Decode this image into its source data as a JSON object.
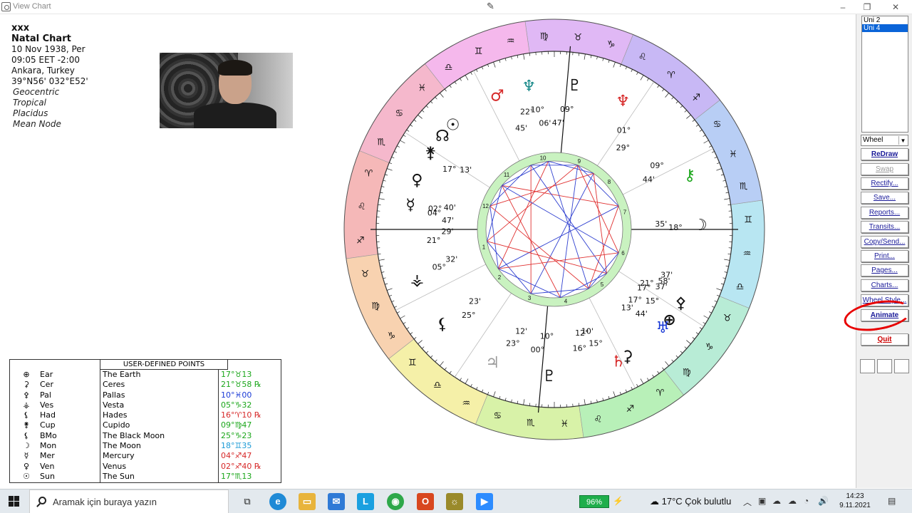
{
  "window": {
    "title": "View Chart"
  },
  "chart_info": {
    "name": "xxx",
    "type": "Natal Chart",
    "date": "10 Nov 1938, Per",
    "time": "09:05 EET -2:00",
    "place": "Ankara, Turkey",
    "coords": "39°N56' 032°E52'",
    "options": [
      "Geocentric",
      "Tropical",
      "Placidus",
      "Mean Node"
    ]
  },
  "udp": {
    "title": "USER-DEFINED POINTS",
    "rows": [
      {
        "glyph": "⊕",
        "abbr": "Ear",
        "name": "The Earth",
        "pos": "17°♉13",
        "color": "#1aa61a"
      },
      {
        "glyph": "⚳",
        "abbr": "Cer",
        "name": "Ceres",
        "pos": "21°♉58 ℞",
        "color": "#1aa61a"
      },
      {
        "glyph": "⚴",
        "abbr": "Pal",
        "name": "Pallas",
        "pos": "10°♓00",
        "color": "#1a3ad6"
      },
      {
        "glyph": "⚶",
        "abbr": "Ves",
        "name": "Vesta",
        "pos": "05°♑32",
        "color": "#1aa61a"
      },
      {
        "glyph": "⚸",
        "abbr": "Had",
        "name": "Hades",
        "pos": "16°♈10 ℞",
        "color": "#d62828"
      },
      {
        "glyph": "⚵",
        "abbr": "Cup",
        "name": "Cupido",
        "pos": "09°♍47",
        "color": "#1aa61a"
      },
      {
        "glyph": "⚸",
        "abbr": "BMo",
        "name": "The Black Moon",
        "pos": "25°♑23",
        "color": "#1aa61a"
      },
      {
        "glyph": "☽",
        "abbr": "Mon",
        "name": "The Moon",
        "pos": "18°♊35",
        "color": "#1a9ad6"
      },
      {
        "glyph": "☿",
        "abbr": "Mer",
        "name": "Mercury",
        "pos": "04°♐47",
        "color": "#d62828"
      },
      {
        "glyph": "♀",
        "abbr": "Ven",
        "name": "Venus",
        "pos": "02°♐40 ℞",
        "color": "#d62828"
      },
      {
        "glyph": "☉",
        "abbr": "Sun",
        "name": "The Sun",
        "pos": "17°♏13",
        "color": "#1aa61a"
      }
    ]
  },
  "side": {
    "universes": [
      "Uni 2",
      "Uni 4"
    ],
    "view_select": "Wheel",
    "buttons": [
      {
        "label": "ReDraw",
        "state": "bold"
      },
      {
        "label": "Swap",
        "state": "disabled"
      },
      {
        "label": "Rectify...",
        "state": ""
      },
      {
        "label": "Save...",
        "state": ""
      },
      {
        "label": "Reports...",
        "state": ""
      },
      {
        "label": "Transits...",
        "state": ""
      },
      {
        "label": "Copy/Send...",
        "state": ""
      },
      {
        "label": "Print...",
        "state": ""
      },
      {
        "label": "Pages...",
        "state": ""
      },
      {
        "label": "Charts...",
        "state": ""
      },
      {
        "label": "Wheel Style...",
        "state": ""
      },
      {
        "label": "Animate",
        "state": "bold"
      },
      {
        "label": "Quit",
        "state": "red"
      }
    ]
  },
  "wheel": {
    "sign_glyphs": [
      "♈",
      "♉",
      "♊",
      "♋",
      "♌",
      "♍",
      "♎",
      "♏",
      "♐",
      "♑",
      "♒",
      "♓"
    ],
    "sign_colors": [
      "#f5b8b8",
      "#f8d2b0",
      "#f5f0a8",
      "#d8f2a8",
      "#b8f0b8",
      "#b8ecd6",
      "#b8e6f2",
      "#b8cef5",
      "#c8b8f5",
      "#e0b8f5",
      "#f5b8ec",
      "#f5b8cc"
    ],
    "house_numbers": [
      "1",
      "2",
      "3",
      "4",
      "5",
      "6",
      "7",
      "8",
      "9",
      "10",
      "11",
      "12"
    ],
    "cusp_labels": [
      {
        "text": "21°",
        "color": "#111"
      },
      {
        "text": "29'",
        "color": "#111"
      },
      {
        "text": "18°",
        "color": "#111"
      },
      {
        "text": "35'",
        "color": "#111"
      },
      {
        "text": "10°",
        "color": "#111"
      },
      {
        "text": "06'",
        "color": "#111"
      },
      {
        "text": "23°",
        "color": "#111"
      },
      {
        "text": "12'",
        "color": "#111"
      },
      {
        "text": "25°",
        "color": "#111"
      },
      {
        "text": "23'",
        "color": "#111"
      },
      {
        "text": "05°",
        "color": "#111"
      },
      {
        "text": "32'",
        "color": "#111"
      },
      {
        "text": "01°",
        "color": "#111"
      },
      {
        "text": "29°",
        "color": "#111"
      },
      {
        "text": "09°",
        "color": "#111"
      },
      {
        "text": "44'",
        "color": "#111"
      },
      {
        "text": "16°",
        "color": "#111"
      },
      {
        "text": "12°",
        "color": "#111"
      },
      {
        "text": "15°",
        "color": "#111"
      },
      {
        "text": "10'",
        "color": "#111"
      },
      {
        "text": "22°",
        "color": "#111"
      },
      {
        "text": "45'",
        "color": "#111"
      },
      {
        "text": "09°",
        "color": "#111"
      },
      {
        "text": "47'",
        "color": "#111"
      },
      {
        "text": "17°",
        "color": "#111"
      },
      {
        "text": "13'",
        "color": "#111"
      },
      {
        "text": "02°",
        "color": "#111"
      },
      {
        "text": "40'",
        "color": "#111"
      },
      {
        "text": "04°",
        "color": "#111"
      },
      {
        "text": "47'",
        "color": "#111"
      },
      {
        "text": "00°",
        "color": "#111"
      },
      {
        "text": "10°",
        "color": "#111"
      },
      {
        "text": "58'",
        "color": "#111"
      },
      {
        "text": "21°",
        "color": "#111"
      },
      {
        "text": "37'",
        "color": "#111"
      },
      {
        "text": "17°",
        "color": "#111"
      },
      {
        "text": "15°",
        "color": "#111"
      },
      {
        "text": "17°",
        "color": "#111"
      },
      {
        "text": "44'",
        "color": "#111"
      },
      {
        "text": "13'",
        "color": "#111"
      },
      {
        "text": "37'",
        "color": "#111"
      }
    ]
  },
  "taskbar": {
    "search_placeholder": "Aramak için buraya yazın",
    "battery": "96%",
    "weather": "17°C  Çok bulutlu",
    "time": "14:23",
    "date": "9.11.2021"
  }
}
